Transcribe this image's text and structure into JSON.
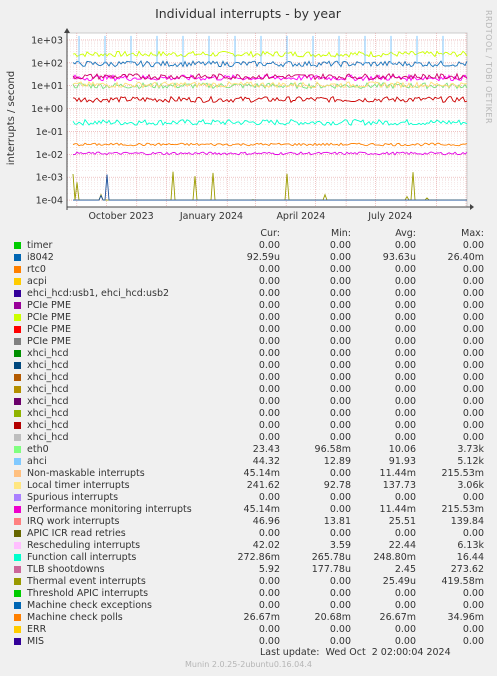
{
  "chart_data": {
    "type": "line",
    "title": "Individual interrupts - by year",
    "ylabel": "interrupts / second",
    "yscale": "log",
    "ylim": [
      5e-05,
      2000
    ],
    "yticks": [
      "1e+03",
      "1e+02",
      "1e+01",
      "1e+00",
      "1e-01",
      "1e-02",
      "1e-03",
      "1e-04"
    ],
    "xticks": [
      "October 2023",
      "January 2024",
      "April 2024",
      "July 2024"
    ],
    "xlim": [
      "2023-08-22",
      "2024-10-02"
    ],
    "grid": true,
    "side_label": "RRDTOOL / TOBI OETIKER",
    "series_approx": [
      {
        "name": "Local timer interrupts",
        "color": "#ccff00",
        "level": 240
      },
      {
        "name": "Function call interrupts",
        "color": "#00ffcc",
        "level": 0.25
      },
      {
        "name": "TLB shootdowns",
        "color": "#cc0000",
        "level": 2.5
      },
      {
        "name": "eth0",
        "color": "#7ae17a",
        "level": 10
      },
      {
        "name": "ahci",
        "color": "#1a75bc",
        "level": 90
      },
      {
        "name": "Non-maskable interrupts",
        "color": "#ffde75",
        "level": 11
      },
      {
        "name": "Rescheduling interrupts",
        "color": "#ff00ff",
        "level": 22
      },
      {
        "name": "Performance monitoring interrupts",
        "color": "#e300e3",
        "level": 0.011
      },
      {
        "name": "IRQ work interrupts",
        "color": "#cc0066",
        "level": 25
      },
      {
        "name": "Thermal event interrupts",
        "color": "#9c9c00",
        "level": 0.0001
      },
      {
        "name": "Machine check polls",
        "color": "#ff8000",
        "level": 0.027
      },
      {
        "name": "i8042",
        "color": "#1a4f9a",
        "level": 0.0001
      }
    ]
  },
  "legend": {
    "headers": {
      "cur": "Cur:",
      "min": "Min:",
      "avg": "Avg:",
      "max": "Max:"
    },
    "rows": [
      {
        "name": "timer",
        "color": "#00cc00",
        "cur": "0.00",
        "min": "0.00",
        "avg": "0.00",
        "max": "0.00"
      },
      {
        "name": "i8042",
        "color": "#0066b3",
        "cur": "92.59u",
        "min": "0.00",
        "avg": "93.63u",
        "max": "26.40m"
      },
      {
        "name": "rtc0",
        "color": "#ff8000",
        "cur": "0.00",
        "min": "0.00",
        "avg": "0.00",
        "max": "0.00"
      },
      {
        "name": "acpi",
        "color": "#ffcc00",
        "cur": "0.00",
        "min": "0.00",
        "avg": "0.00",
        "max": "0.00"
      },
      {
        "name": "ehci_hcd:usb1, ehci_hcd:usb2",
        "color": "#330099",
        "cur": "0.00",
        "min": "0.00",
        "avg": "0.00",
        "max": "0.00"
      },
      {
        "name": "PCIe PME",
        "color": "#990099",
        "cur": "0.00",
        "min": "0.00",
        "avg": "0.00",
        "max": "0.00"
      },
      {
        "name": "PCIe PME",
        "color": "#ccff00",
        "cur": "0.00",
        "min": "0.00",
        "avg": "0.00",
        "max": "0.00"
      },
      {
        "name": "PCIe PME",
        "color": "#ff0000",
        "cur": "0.00",
        "min": "0.00",
        "avg": "0.00",
        "max": "0.00"
      },
      {
        "name": "PCIe PME",
        "color": "#808080",
        "cur": "0.00",
        "min": "0.00",
        "avg": "0.00",
        "max": "0.00"
      },
      {
        "name": "xhci_hcd",
        "color": "#008f00",
        "cur": "0.00",
        "min": "0.00",
        "avg": "0.00",
        "max": "0.00"
      },
      {
        "name": "xhci_hcd",
        "color": "#00487d",
        "cur": "0.00",
        "min": "0.00",
        "avg": "0.00",
        "max": "0.00"
      },
      {
        "name": "xhci_hcd",
        "color": "#b35a00",
        "cur": "0.00",
        "min": "0.00",
        "avg": "0.00",
        "max": "0.00"
      },
      {
        "name": "xhci_hcd",
        "color": "#b38f00",
        "cur": "0.00",
        "min": "0.00",
        "avg": "0.00",
        "max": "0.00"
      },
      {
        "name": "xhci_hcd",
        "color": "#6b006b",
        "cur": "0.00",
        "min": "0.00",
        "avg": "0.00",
        "max": "0.00"
      },
      {
        "name": "xhci_hcd",
        "color": "#8fb300",
        "cur": "0.00",
        "min": "0.00",
        "avg": "0.00",
        "max": "0.00"
      },
      {
        "name": "xhci_hcd",
        "color": "#b30000",
        "cur": "0.00",
        "min": "0.00",
        "avg": "0.00",
        "max": "0.00"
      },
      {
        "name": "xhci_hcd",
        "color": "#bebebe",
        "cur": "0.00",
        "min": "0.00",
        "avg": "0.00",
        "max": "0.00"
      },
      {
        "name": "eth0",
        "color": "#80ff80",
        "cur": "23.43",
        "min": "96.58m",
        "avg": "10.06",
        "max": "3.73k"
      },
      {
        "name": "ahci",
        "color": "#80c9ff",
        "cur": "44.32",
        "min": "12.89",
        "avg": "91.93",
        "max": "5.12k"
      },
      {
        "name": "Non-maskable interrupts",
        "color": "#ffc080",
        "cur": "45.14m",
        "min": "0.00",
        "avg": "11.44m",
        "max": "215.53m"
      },
      {
        "name": "Local timer interrupts",
        "color": "#ffe680",
        "cur": "241.62",
        "min": "92.78",
        "avg": "137.73",
        "max": "3.06k"
      },
      {
        "name": "Spurious interrupts",
        "color": "#aa80ff",
        "cur": "0.00",
        "min": "0.00",
        "avg": "0.00",
        "max": "0.00"
      },
      {
        "name": "Performance monitoring interrupts",
        "color": "#ee00cc",
        "cur": "45.14m",
        "min": "0.00",
        "avg": "11.44m",
        "max": "215.53m"
      },
      {
        "name": "IRQ work interrupts",
        "color": "#ff8080",
        "cur": "46.96",
        "min": "13.81",
        "avg": "25.51",
        "max": "139.84"
      },
      {
        "name": "APIC ICR read retries",
        "color": "#666600",
        "cur": "0.00",
        "min": "0.00",
        "avg": "0.00",
        "max": "0.00"
      },
      {
        "name": "Rescheduling interrupts",
        "color": "#ffbfff",
        "cur": "42.02",
        "min": "3.59",
        "avg": "22.44",
        "max": "6.13k"
      },
      {
        "name": "Function call interrupts",
        "color": "#00ffcc",
        "cur": "272.86m",
        "min": "265.78u",
        "avg": "248.80m",
        "max": "16.44"
      },
      {
        "name": "TLB shootdowns",
        "color": "#cc6699",
        "cur": "5.92",
        "min": "177.78u",
        "avg": "2.45",
        "max": "273.62"
      },
      {
        "name": "Thermal event interrupts",
        "color": "#999900",
        "cur": "0.00",
        "min": "0.00",
        "avg": "25.49u",
        "max": "419.58m"
      },
      {
        "name": "Threshold APIC interrupts",
        "color": "#00cc00",
        "cur": "0.00",
        "min": "0.00",
        "avg": "0.00",
        "max": "0.00"
      },
      {
        "name": "Machine check exceptions",
        "color": "#0066b3",
        "cur": "0.00",
        "min": "0.00",
        "avg": "0.00",
        "max": "0.00"
      },
      {
        "name": "Machine check polls",
        "color": "#ff8000",
        "cur": "26.67m",
        "min": "20.68m",
        "avg": "26.67m",
        "max": "34.96m"
      },
      {
        "name": "ERR",
        "color": "#ffcc00",
        "cur": "0.00",
        "min": "0.00",
        "avg": "0.00",
        "max": "0.00"
      },
      {
        "name": "MIS",
        "color": "#330099",
        "cur": "0.00",
        "min": "0.00",
        "avg": "0.00",
        "max": "0.00"
      }
    ]
  },
  "last_update": "Last update:  Wed Oct  2 02:00:04 2024",
  "footer": "Munin 2.0.25-2ubuntu0.16.04.4"
}
